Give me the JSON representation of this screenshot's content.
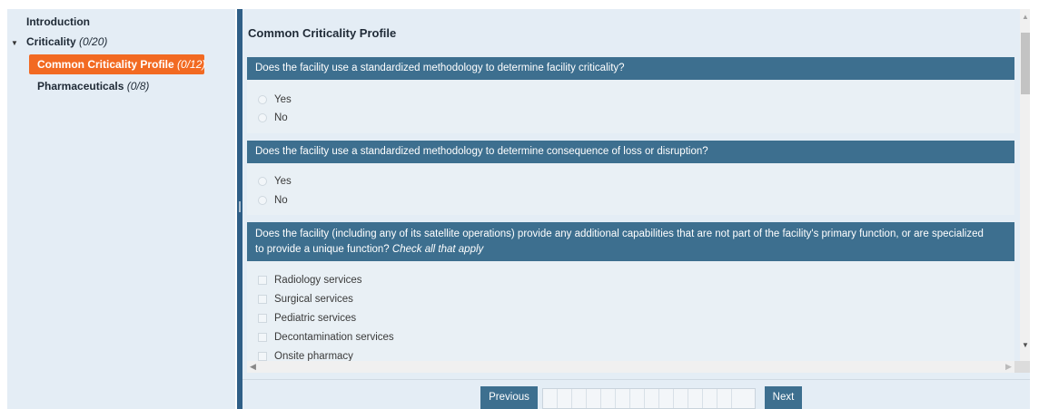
{
  "sidebar": {
    "items": [
      {
        "label": "Introduction",
        "count": ""
      },
      {
        "label": "Criticality",
        "count": "(0/20)"
      },
      {
        "label": "Common Criticality Profile",
        "count": "(0/12)"
      },
      {
        "label": "Pharmaceuticals",
        "count": "(0/8)"
      }
    ],
    "active_color": "#f26a22"
  },
  "main": {
    "title": "Common Criticality Profile",
    "questions": [
      {
        "text": "Does the facility use a standardized methodology to determine facility criticality?",
        "options": [
          "Yes",
          "No"
        ]
      },
      {
        "text": "Does the facility use a standardized methodology to determine consequence of loss or disruption?",
        "options": [
          "Yes",
          "No"
        ]
      },
      {
        "text_line1": "Does the facility (including any of its satellite operations) provide any additional capabilities that are not part of the facility's primary function, or are specialized",
        "text_line2": "to provide a unique function?",
        "hint": "Check all that apply",
        "options": [
          "Radiology services",
          "Surgical services",
          "Pediatric services",
          "Decontamination services",
          "Onsite pharmacy"
        ]
      }
    ],
    "header_color": "#3d6f8f"
  },
  "footer": {
    "previous_label": "Previous",
    "next_label": "Next"
  },
  "icons": {
    "caret": "caret-down-icon",
    "scroll_up": "arrow-up-icon",
    "scroll_down": "arrow-down-icon",
    "scroll_left": "arrow-left-icon",
    "scroll_right": "arrow-right-icon"
  }
}
